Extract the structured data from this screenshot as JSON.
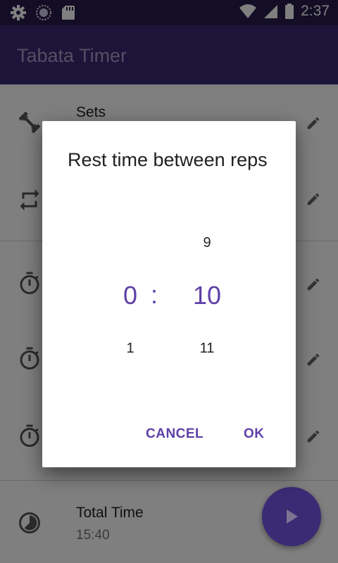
{
  "status_bar": {
    "time": "2:37"
  },
  "app_bar": {
    "title": "Tabata Timer"
  },
  "list": {
    "rows": [
      {
        "label": "Sets",
        "icon": "dumbbell-icon"
      },
      {
        "label": "",
        "icon": "repeat-icon"
      },
      {
        "label": "",
        "icon": "stopwatch-icon"
      },
      {
        "label": "",
        "icon": "stopwatch-icon"
      },
      {
        "label": "",
        "icon": "stopwatch-icon"
      }
    ],
    "total": {
      "label": "Total Time",
      "value": "15:40",
      "icon": "timelapse-icon"
    }
  },
  "dialog": {
    "title": "Rest time between reps",
    "minutes": {
      "prev": "",
      "current": "0",
      "next": "1"
    },
    "separator": ":",
    "seconds": {
      "prev": "9",
      "current": "10",
      "next": "11"
    },
    "cancel_label": "CANCEL",
    "ok_label": "OK"
  },
  "colors": {
    "accent": "#5e3fa8",
    "app_bar": "#3a2a72",
    "status_bar": "#261a4d"
  }
}
